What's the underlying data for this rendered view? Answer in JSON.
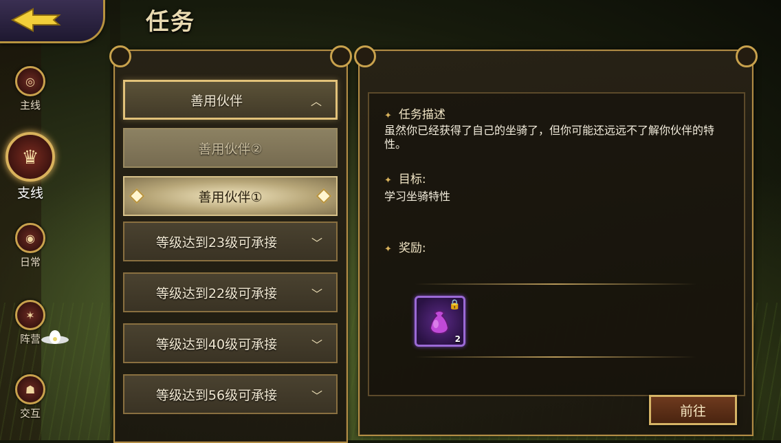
{
  "header": {
    "title": "任务"
  },
  "sidenav": [
    {
      "label": "主线",
      "icon": "scroll-icon",
      "active": false
    },
    {
      "label": "支线",
      "icon": "crown-icon",
      "active": true
    },
    {
      "label": "日常",
      "icon": "spiral-icon",
      "active": false
    },
    {
      "label": "阵营",
      "icon": "emblem-icon",
      "active": false
    },
    {
      "label": "交互",
      "icon": "people-icon",
      "active": false
    }
  ],
  "quest_list": {
    "group_title": "善用伙伴",
    "sub_quests": [
      "善用伙伴②",
      "善用伙伴①"
    ],
    "locked_quests": [
      "等级达到23级可承接",
      "等级达到22级可承接",
      "等级达到40级可承接",
      "等级达到56级可承接"
    ]
  },
  "detail": {
    "desc_heading": "任务描述",
    "desc_text": "虽然你已经获得了自己的坐骑了，但你可能还远远不了解你伙伴的特性。",
    "goal_heading": "目标:",
    "goal_text": "学习坐骑特性",
    "reward_heading": "奖励:",
    "reward_item": {
      "icon": "purple-bag-icon",
      "count": "2",
      "locked": true
    }
  },
  "go_button_label": "前往",
  "colors": {
    "gold": "#c9a24d",
    "reward_border": "#9b6ad6",
    "panel_bg": "#281f14"
  }
}
